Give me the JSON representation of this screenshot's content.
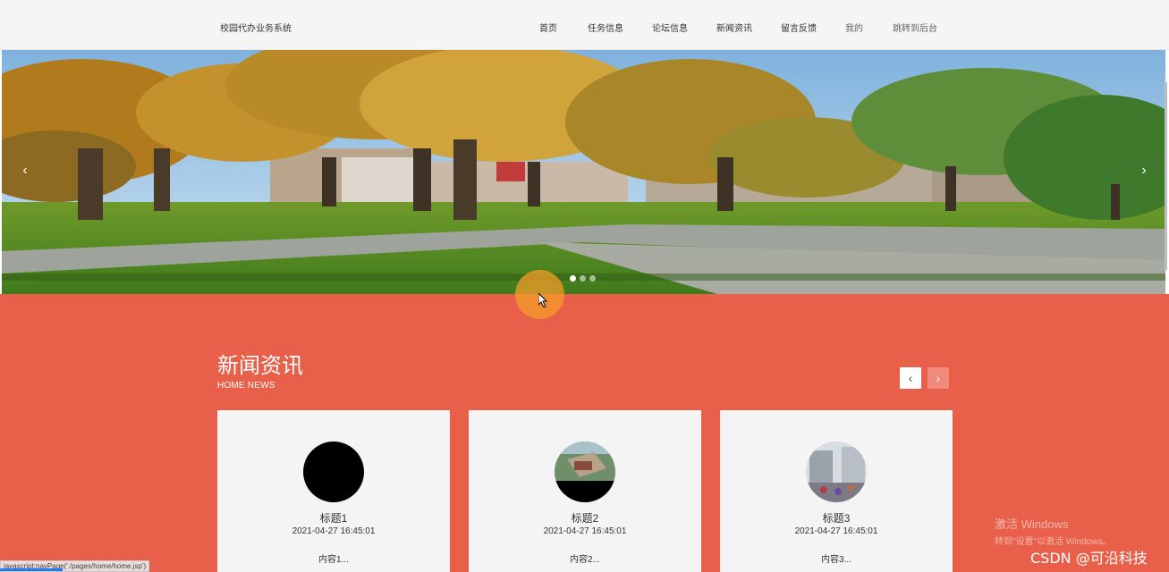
{
  "header": {
    "brand": "校园代办业务系统",
    "nav": [
      {
        "label": "首页"
      },
      {
        "label": "任务信息"
      },
      {
        "label": "论坛信息"
      },
      {
        "label": "新闻资讯"
      },
      {
        "label": "留言反馈"
      },
      {
        "label": "我的"
      },
      {
        "label": "跳转到后台"
      }
    ]
  },
  "carousel": {
    "prev_icon": "chevron-left-icon",
    "next_icon": "chevron-right-icon",
    "slide_count": 3,
    "active_slide": 1
  },
  "news": {
    "title": "新闻资讯",
    "subtitle": "HOME NEWS",
    "cards": [
      {
        "title": "标题1",
        "time": "2021-04-27 16:45:01",
        "content": "内容1..."
      },
      {
        "title": "标题2",
        "time": "2021-04-27 16:45:01",
        "content": "内容2..."
      },
      {
        "title": "标题3",
        "time": "2021-04-27 16:45:01",
        "content": "内容3..."
      }
    ]
  },
  "overlays": {
    "activate_line1": "激活 Windows",
    "activate_line2": "转到\"设置\"以激活 Windows。",
    "watermark": "CSDN @可沿科技",
    "status_url": "javascript:navPage('./pages/home/home.jsp')"
  },
  "colors": {
    "news_bg": "#e9604a",
    "header_bg": "#f5f5f5",
    "card_bg": "#f4f4f4"
  }
}
